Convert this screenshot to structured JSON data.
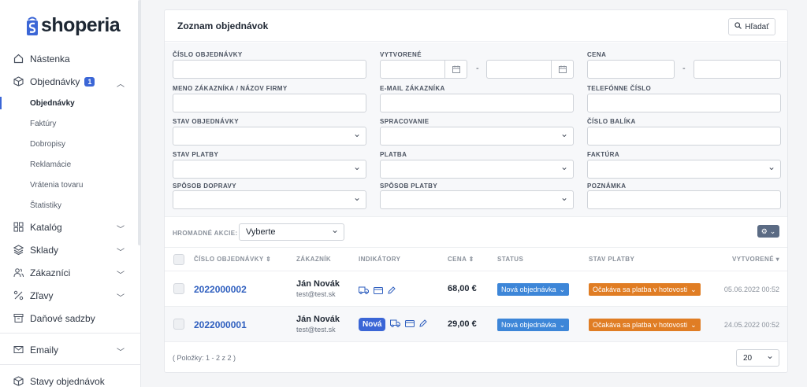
{
  "app": {
    "brand": "shoperia"
  },
  "sidebar": {
    "items": [
      {
        "label": "Nástenka",
        "icon": "home-icon"
      },
      {
        "label": "Objednávky",
        "icon": "box-icon",
        "badge": "1"
      },
      {
        "label": "Katalóg",
        "icon": "grid-icon"
      },
      {
        "label": "Sklady",
        "icon": "layers-icon"
      },
      {
        "label": "Zákazníci",
        "icon": "users-icon"
      },
      {
        "label": "Zľavy",
        "icon": "percent-icon"
      },
      {
        "label": "Daňové sadzby",
        "icon": "archive-icon"
      },
      {
        "label": "Emaily",
        "icon": "mail-icon"
      },
      {
        "label": "Stavy objednávok",
        "icon": "box-icon"
      }
    ],
    "subitems": [
      "Objednávky",
      "Faktúry",
      "Dobropisy",
      "Reklamácie",
      "Vrátenia tovaru",
      "Štatistiky"
    ]
  },
  "main": {
    "title": "Zoznam objednávok",
    "search_label": "Hľadať"
  },
  "filters": {
    "order_number": "ČÍSLO OBJEDNÁVKY",
    "created": "VYTVORENÉ",
    "price": "CENA",
    "customer": "MENO ZÁKAZNÍKA / NÁZOV FIRMY",
    "email": "E-MAIL ZÁKAZNÍKA",
    "phone": "TELEFÓNNE ČÍSLO",
    "order_status": "STAV OBJEDNÁVKY",
    "processing": "SPRACOVANIE",
    "parcel": "ČÍSLO BALÍKA",
    "payment_status": "STAV PLATBY",
    "payment": "PLATBA",
    "invoice": "FAKTÚRA",
    "shipping": "SPÔSOB DOPRAVY",
    "payment_method": "SPÔSOB PLATBY",
    "note": "POZNÁMKA",
    "range_dash": "-"
  },
  "bulk": {
    "label": "HROMADNÉ AKCIE:",
    "select_value": "Vyberte"
  },
  "table": {
    "headers": {
      "order_no": "ČÍSLO OBJEDNÁVKY ⇕",
      "customer": "ZÁKAZNÍK",
      "indicators": "INDIKÁTORY",
      "price": "CENA ⇕",
      "status": "STATUS",
      "pay_status": "STAV PLATBY",
      "created": "VYTVORENÉ ▾"
    },
    "rows": [
      {
        "order_no": "2022000002",
        "customer_name": "Ján Novák",
        "customer_email": "test@test.sk",
        "new_badge": "",
        "price": "68,00 €",
        "status": "Nová objednávka",
        "pay_status": "Očakáva sa platba v hotovosti",
        "created": "05.06.2022 00:52"
      },
      {
        "order_no": "2022000001",
        "customer_name": "Ján Novák",
        "customer_email": "test@test.sk",
        "new_badge": "Nová",
        "price": "29,00 €",
        "status": "Nová objednávka",
        "pay_status": "Očakáva sa platba v hotovosti",
        "created": "24.05.2022 00:52"
      }
    ],
    "footer": "( Položky: 1 - 2 z 2 )",
    "page_size": "20"
  },
  "colors": {
    "accent": "#3b66d6",
    "status": "#3d86d8",
    "payment": "#e07d24"
  }
}
